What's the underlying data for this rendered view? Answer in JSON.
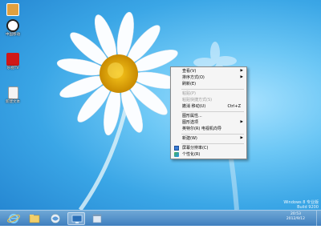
{
  "desktop": {
    "icons": [
      {
        "label": "",
        "icon": "app-icon",
        "color": "#e0a040"
      },
      {
        "label": "中国移动",
        "icon": "shortcut-icon",
        "color": "#c02020"
      },
      {
        "label": "乐视TV",
        "icon": "app-icon-red",
        "color": "#d01818"
      },
      {
        "label": "新建文本",
        "icon": "text-file-icon",
        "color": "#f4f4f4"
      }
    ]
  },
  "context_menu": {
    "items": [
      {
        "label": "查看(V)",
        "submenu": true,
        "disabled": false
      },
      {
        "label": "排序方式(O)",
        "submenu": true,
        "disabled": false
      },
      {
        "label": "刷新(E)",
        "submenu": false,
        "disabled": false
      },
      {
        "label": "粘贴(P)",
        "submenu": false,
        "disabled": true
      },
      {
        "label": "粘贴快捷方式(S)",
        "submenu": false,
        "disabled": true
      },
      {
        "label": "撤消 移动(U)",
        "shortcut": "Ctrl+Z",
        "submenu": false,
        "disabled": false
      },
      {
        "label": "图形属性...",
        "submenu": false,
        "disabled": false
      },
      {
        "label": "图形选项",
        "submenu": true,
        "disabled": false
      },
      {
        "label": "英特尔(R) 电视机向导",
        "submenu": false,
        "disabled": false
      },
      {
        "label": "新建(W)",
        "submenu": true,
        "disabled": false
      },
      {
        "label": "屏幕分辨率(C)",
        "icon": "display-icon",
        "submenu": false,
        "disabled": false
      },
      {
        "label": "个性化(R)",
        "icon": "personalize-icon",
        "submenu": false,
        "disabled": false
      }
    ]
  },
  "taskbar": {
    "apps": [
      "ie-icon",
      "folder-icon",
      "media-icon",
      "network-icon",
      "window-icon"
    ],
    "time": "20:53",
    "date": "2012/9/12"
  },
  "watermark": {
    "line1": "Windows 8 专业版",
    "line2": "Build 9200"
  },
  "colors": {
    "accent": "#3aa6e6",
    "menu_bg": "#f5f5f5",
    "taskbar": "#4a8ac8"
  }
}
